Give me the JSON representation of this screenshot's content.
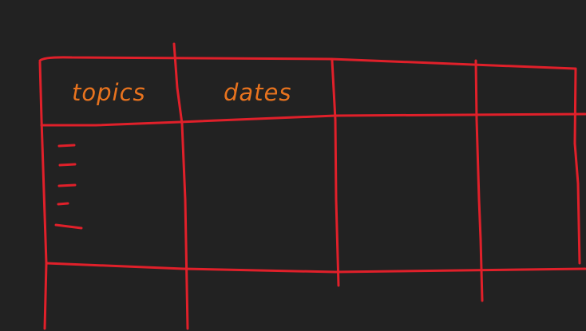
{
  "table": {
    "headers": [
      "topics",
      "dates"
    ],
    "bullet_count": 5
  },
  "colors": {
    "background": "#222222",
    "line": "#e0202a",
    "text": "#e8731e"
  }
}
